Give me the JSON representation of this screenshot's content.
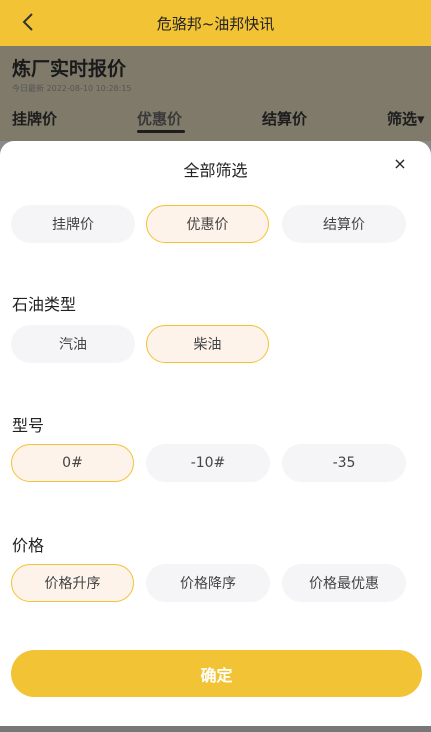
{
  "app": {
    "title": "危骆邦~油邦快讯",
    "accent": "#f2c335"
  },
  "background_page": {
    "headline": "炼厂实时报价",
    "subtitle": "今日最新  2022-08-10 10:28:15",
    "tabs": [
      "挂牌价",
      "优惠价",
      "结算价",
      "筛选▾"
    ]
  },
  "sheet": {
    "title": "全部筛选",
    "close_glyph": "×",
    "price_kind": {
      "options": [
        "挂牌价",
        "优惠价",
        "结算价"
      ],
      "selected": "优惠价"
    },
    "oil_type": {
      "label": "石油类型",
      "options": [
        "汽油",
        "柴油"
      ],
      "selected": "柴油"
    },
    "model": {
      "label": "型号",
      "options": [
        "0#",
        "-10#",
        "-35"
      ],
      "selected": "0#"
    },
    "price_sort": {
      "label": "价格",
      "options": [
        "价格升序",
        "价格降序",
        "价格最优惠"
      ],
      "selected": "价格升序"
    },
    "confirm_label": "确定"
  }
}
